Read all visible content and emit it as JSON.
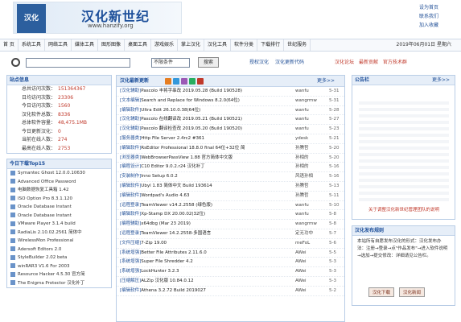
{
  "header": {
    "logo_badge": "汉化",
    "logo_cn": "汉化新世纪",
    "logo_url": "www.hanzify.org",
    "links": [
      "设为首页",
      "联系我们",
      "加入收藏"
    ]
  },
  "nav": {
    "items": [
      "首 页",
      "系统工具",
      "网络工具",
      "媒体工具",
      "图形图像",
      "桌面工具",
      "游戏娱乐",
      "掌上汉化",
      "汉化工具",
      "软件分类",
      "下载排行",
      "世纪服务"
    ],
    "date": "2019年06月01日 星期六"
  },
  "search": {
    "placeholder": "",
    "scope": "不限条件",
    "button": "搜索",
    "links": [
      "授权汉化",
      "汉化更新代码"
    ],
    "quick": [
      "汉化论坛",
      "最新贡献",
      "官方技术群"
    ]
  },
  "stats": {
    "title": "站点信息",
    "items": [
      {
        "label": "总共访问次数：",
        "value": "151364367"
      },
      {
        "label": "日均访问次数：",
        "value": "23306"
      },
      {
        "label": "今日访问次数：",
        "value": "1560"
      },
      {
        "label": "汉化软件总数：",
        "value": "8336"
      },
      {
        "label": "总体软件容量：",
        "value": "48,475.1MB"
      },
      {
        "label": "今日更新汉化：",
        "value": "0"
      },
      {
        "label": "当前在线人数：",
        "value": "274"
      },
      {
        "label": "最高在线人数：",
        "value": "2753"
      }
    ]
  },
  "top15": {
    "title": "今日下载Top15",
    "items": [
      "Symantec Ghost 12.0.0.10630",
      "Advanced Office Password",
      "电脑数据恢复工具箱 1.42",
      "ISO Option Pro 8.3.1.120",
      "Oracle Database Instant",
      "Oracle Database Instant",
      "VMware Player 3.1.4 build",
      "RadiaLis 2.10.02.2561 简体中",
      "WirelessMon Professional",
      "Adersoft Editors 2.0",
      "StyleBuilder 2.02 beta",
      "winRAR3 V1.6 For 2003",
      "Resource Hacker 4.5.30 官方简",
      "The Enigma Protector 汉化补丁"
    ]
  },
  "latest": {
    "title": "汉化最新更新",
    "more": "更多>>",
    "rows": [
      {
        "cat": "[汉化辅助]",
        "title": "Pascolo 丰将字串改 2019.05.28 (Build 190528)",
        "author": "wanfu",
        "date": "5-31"
      },
      {
        "cat": "[文本编辑]",
        "title": "Search and Replace for Windows 8.2.0(64位)",
        "author": "wangrmw",
        "date": "5-31"
      },
      {
        "cat": "[编辑软件]",
        "title": "Ultra Edit 26.10.0.38(64位)",
        "author": "wanfu",
        "date": "5-28"
      },
      {
        "cat": "[汉化辅助]",
        "title": "Pascolo 在线翻译改 2019.05.21 (Build 190521)",
        "author": "wanfu",
        "date": "5-27"
      },
      {
        "cat": "[汉化辅助]",
        "title": "Pascolo 翻译检查改 2019.05.20 (Build 190520)",
        "author": "wanfu",
        "date": "5-23"
      },
      {
        "cat": "[服务器类]",
        "title": "Http File Server 2.4rc2 #361",
        "author": "ydesk",
        "date": "5-21"
      },
      {
        "cat": "[编辑软件]",
        "title": "RsEditor Professional 18.8.0 final 64位+32位 简",
        "author": "孙腾哲",
        "date": "5-20"
      },
      {
        "cat": "[浏览器类]",
        "title": "WebBrowserPassView 1.88 官方简体中文版",
        "author": "孙相的",
        "date": "5-20"
      },
      {
        "cat": "[编程设计]",
        "title": "C10 Editor 9.0.2.r24 汉化补丁",
        "author": "孙相的",
        "date": "5-16"
      },
      {
        "cat": "[安装制作]",
        "title": "Inno Setup 6.0.2",
        "author": "风语孙相",
        "date": "5-16"
      },
      {
        "cat": "[编辑软件]",
        "title": "Ubyl 1.83 简体中文 Build 193614",
        "author": "孙腾哲",
        "date": "5-13"
      },
      {
        "cat": "[编辑软件]",
        "title": "Wordpad's Audio 4.63",
        "author": "孙腾哲",
        "date": "5-11"
      },
      {
        "cat": "[远程登录]",
        "title": "TeamViewer v14.2.2558 (绿色版)",
        "author": "wanfu",
        "date": "5-10"
      },
      {
        "cat": "[编辑软件]",
        "title": "Xp-Stamp DX 20.00.02(32位)",
        "author": "wanfu",
        "date": "5-8"
      },
      {
        "cat": "[编程辅助]",
        "title": "x64dbg (Mar 23 2019)",
        "author": "wangrmw",
        "date": "5-8"
      },
      {
        "cat": "[远程登录]",
        "title": "TeamViewer 14.2.2558-多国语言",
        "author": "定无功中",
        "date": "5-7"
      },
      {
        "cat": "[文件压缩]",
        "title": "7-Zip 19.00",
        "author": "meFoL",
        "date": "5-6"
      },
      {
        "cat": "[系统增强]",
        "title": "Better File Attributes 2.11.6.0",
        "author": "AWei",
        "date": "5-5"
      },
      {
        "cat": "[系统增强]",
        "title": "Super File Shredder 4.2",
        "author": "AWei",
        "date": "5-3"
      },
      {
        "cat": "[系统增强]",
        "title": "LockHunter 3.2.3",
        "author": "AWei",
        "date": "5-3"
      },
      {
        "cat": "[压缩解压]",
        "title": "ALZip 汉化版 10.84.0.12",
        "author": "AWei",
        "date": "5-3"
      },
      {
        "cat": "[编辑软件]",
        "title": "Athena 3.2.72 Build 2019027",
        "author": "AWei",
        "date": "5-2"
      }
    ]
  },
  "ads": {
    "title": "公告栏",
    "more": "更多>>",
    "text": "关于调整汉化新世纪管理团队的说明"
  },
  "notice": {
    "title": "汉化发布规则",
    "text": "本站所有自愿发布汉化的形式：汉化发布办法：注册→登录→点\"作品发布\"→进入软件说明→选加→提交修改：详细请见公告栏。",
    "badges": [
      "汉化下载",
      "汉化新闻"
    ]
  },
  "colors": {
    "accent": "#1d4f9a",
    "highlight": "#c0392b",
    "panel_header": "#e6eef8",
    "border": "#b9cde6"
  }
}
